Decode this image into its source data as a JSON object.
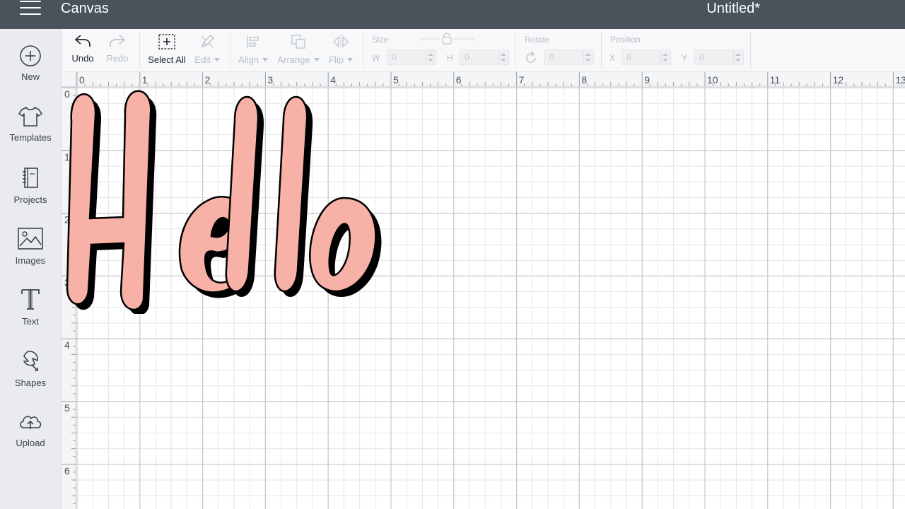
{
  "topbar": {
    "app_title": "Canvas",
    "document_title": "Untitled*",
    "menu_icon": "hamburger-menu-icon",
    "background_color": "#4a535b"
  },
  "sidebar": {
    "items": [
      {
        "label": "New",
        "icon": "plus-circle-icon"
      },
      {
        "label": "Templates",
        "icon": "tshirt-icon"
      },
      {
        "label": "Projects",
        "icon": "notebook-icon"
      },
      {
        "label": "Images",
        "icon": "image-icon"
      },
      {
        "label": "Text",
        "icon": "text-t-icon"
      },
      {
        "label": "Shapes",
        "icon": "shapes-icon"
      },
      {
        "label": "Upload",
        "icon": "cloud-upload-icon"
      }
    ]
  },
  "toolbar": {
    "undo_label": "Undo",
    "redo_label": "Redo",
    "select_all_label": "Select All",
    "edit_label": "Edit",
    "align_label": "Align",
    "arrange_label": "Arrange",
    "flip_label": "Flip",
    "size_label": "Size",
    "width_label": "W",
    "height_label": "H",
    "width_value": "0",
    "height_value": "0",
    "rotate_label": "Rotate",
    "rotate_value": "0",
    "position_label": "Position",
    "x_label": "X",
    "y_label": "Y",
    "x_value": "0",
    "y_value": "0"
  },
  "rulers": {
    "horizontal": [
      "0",
      "1",
      "2",
      "3",
      "4",
      "5",
      "6",
      "7",
      "8",
      "9",
      "10",
      "11",
      "12",
      "13"
    ],
    "vertical": [
      "0",
      "1",
      "2",
      "3",
      "4",
      "5",
      "6"
    ]
  },
  "canvas": {
    "text": "Hello",
    "fill_color": "#f7b1a6",
    "shadow_color": "#000000",
    "grid_minor_color": "#e6e6e6",
    "grid_major_color": "#c8c8c8"
  }
}
